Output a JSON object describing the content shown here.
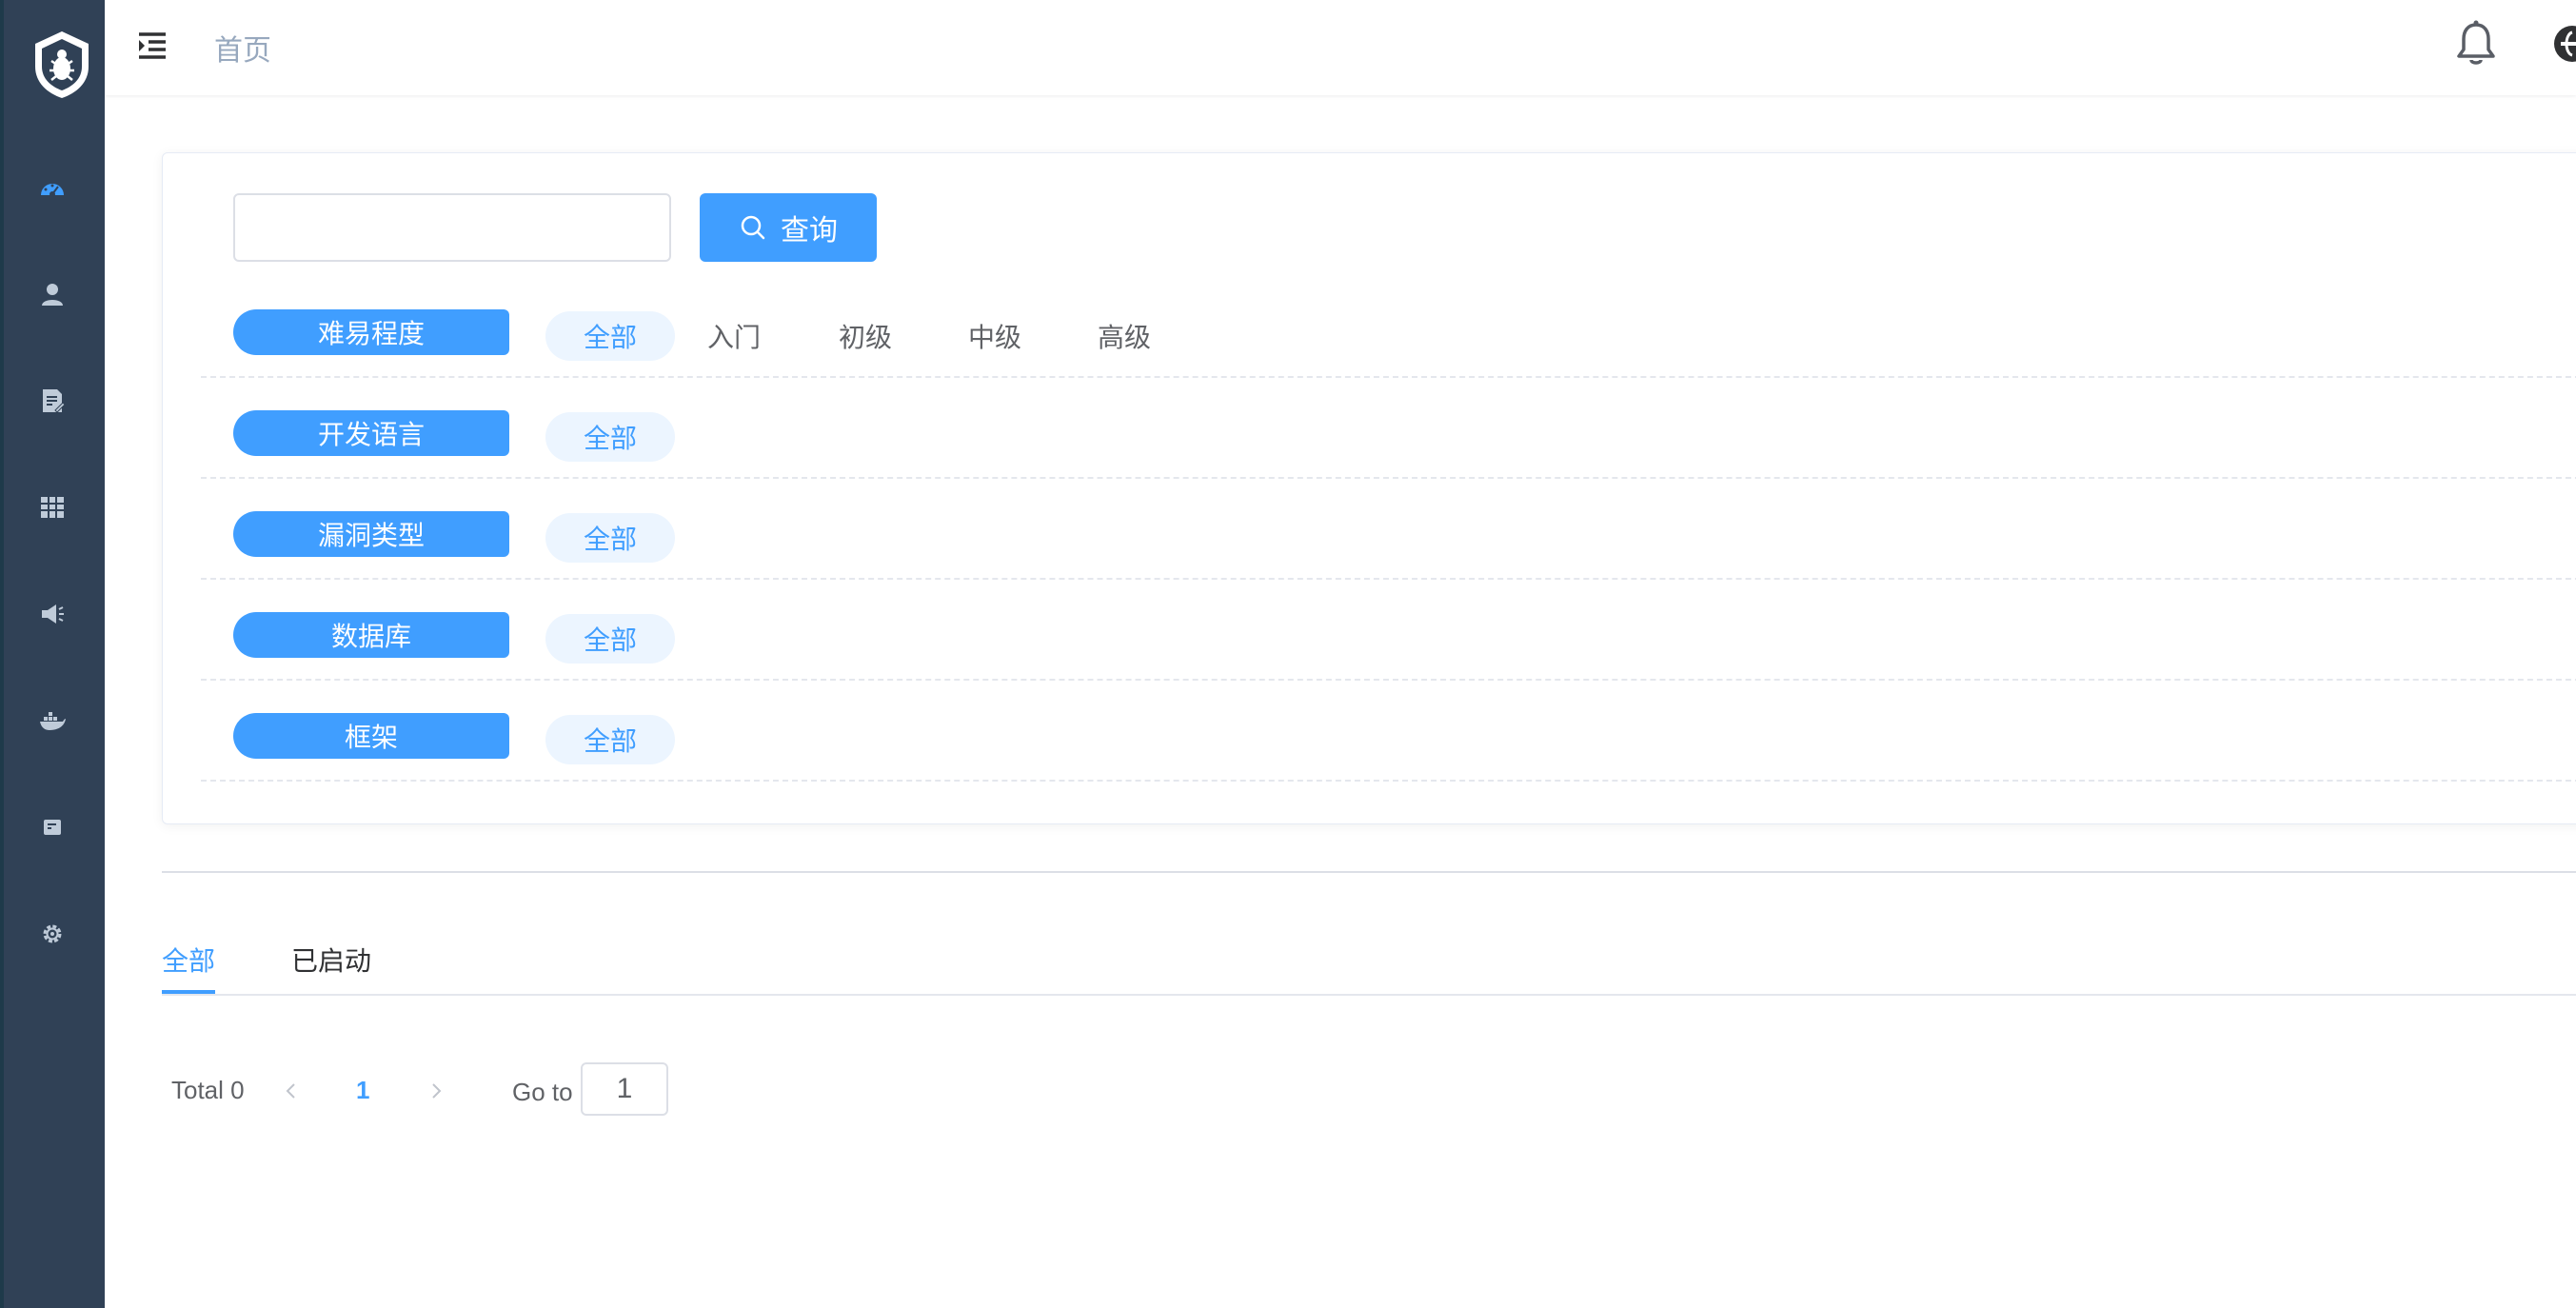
{
  "header": {
    "breadcrumb": "首页"
  },
  "sidebar": {
    "items": [
      {
        "icon": "dashboard-icon"
      },
      {
        "icon": "user-icon"
      },
      {
        "icon": "edit-document-icon"
      },
      {
        "icon": "table-icon"
      },
      {
        "icon": "megaphone-icon"
      },
      {
        "icon": "docker-icon"
      },
      {
        "icon": "form-icon"
      },
      {
        "icon": "gear-icon"
      }
    ]
  },
  "search": {
    "value": "",
    "placeholder": "",
    "button_label": "查询"
  },
  "filters": [
    {
      "label": "难易程度",
      "options": [
        "全部",
        "入门",
        "初级",
        "中级",
        "高级"
      ]
    },
    {
      "label": "开发语言",
      "options": [
        "全部"
      ]
    },
    {
      "label": "漏洞类型",
      "options": [
        "全部"
      ]
    },
    {
      "label": "数据库",
      "options": [
        "全部"
      ]
    },
    {
      "label": "框架",
      "options": [
        "全部"
      ]
    }
  ],
  "tabs": [
    "全部",
    "已启动"
  ],
  "pagination": {
    "total": "Total 0",
    "current_page": "1",
    "goto_label": "Go to",
    "goto_value": "1"
  },
  "colors": {
    "primary": "#409eff",
    "sidebar_bg": "#304156"
  }
}
